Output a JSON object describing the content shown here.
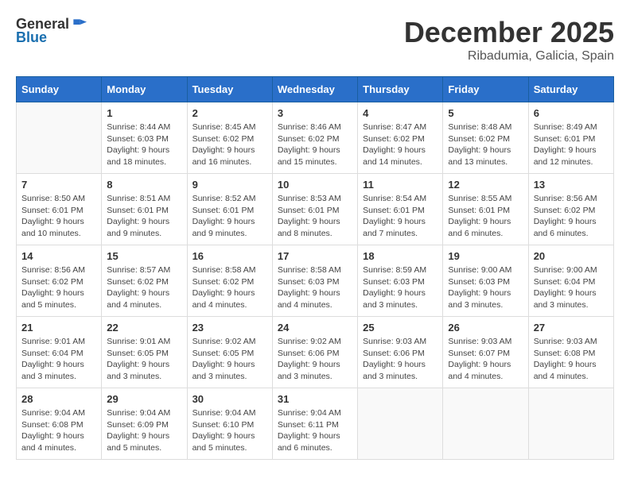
{
  "header": {
    "logo_general": "General",
    "logo_blue": "Blue",
    "month_year": "December 2025",
    "location": "Ribadumia, Galicia, Spain"
  },
  "weekdays": [
    "Sunday",
    "Monday",
    "Tuesday",
    "Wednesday",
    "Thursday",
    "Friday",
    "Saturday"
  ],
  "weeks": [
    [
      {
        "day": "",
        "info": ""
      },
      {
        "day": "1",
        "info": "Sunrise: 8:44 AM\nSunset: 6:03 PM\nDaylight: 9 hours\nand 18 minutes."
      },
      {
        "day": "2",
        "info": "Sunrise: 8:45 AM\nSunset: 6:02 PM\nDaylight: 9 hours\nand 16 minutes."
      },
      {
        "day": "3",
        "info": "Sunrise: 8:46 AM\nSunset: 6:02 PM\nDaylight: 9 hours\nand 15 minutes."
      },
      {
        "day": "4",
        "info": "Sunrise: 8:47 AM\nSunset: 6:02 PM\nDaylight: 9 hours\nand 14 minutes."
      },
      {
        "day": "5",
        "info": "Sunrise: 8:48 AM\nSunset: 6:02 PM\nDaylight: 9 hours\nand 13 minutes."
      },
      {
        "day": "6",
        "info": "Sunrise: 8:49 AM\nSunset: 6:01 PM\nDaylight: 9 hours\nand 12 minutes."
      }
    ],
    [
      {
        "day": "7",
        "info": "Sunrise: 8:50 AM\nSunset: 6:01 PM\nDaylight: 9 hours\nand 10 minutes."
      },
      {
        "day": "8",
        "info": "Sunrise: 8:51 AM\nSunset: 6:01 PM\nDaylight: 9 hours\nand 9 minutes."
      },
      {
        "day": "9",
        "info": "Sunrise: 8:52 AM\nSunset: 6:01 PM\nDaylight: 9 hours\nand 9 minutes."
      },
      {
        "day": "10",
        "info": "Sunrise: 8:53 AM\nSunset: 6:01 PM\nDaylight: 9 hours\nand 8 minutes."
      },
      {
        "day": "11",
        "info": "Sunrise: 8:54 AM\nSunset: 6:01 PM\nDaylight: 9 hours\nand 7 minutes."
      },
      {
        "day": "12",
        "info": "Sunrise: 8:55 AM\nSunset: 6:01 PM\nDaylight: 9 hours\nand 6 minutes."
      },
      {
        "day": "13",
        "info": "Sunrise: 8:56 AM\nSunset: 6:02 PM\nDaylight: 9 hours\nand 6 minutes."
      }
    ],
    [
      {
        "day": "14",
        "info": "Sunrise: 8:56 AM\nSunset: 6:02 PM\nDaylight: 9 hours\nand 5 minutes."
      },
      {
        "day": "15",
        "info": "Sunrise: 8:57 AM\nSunset: 6:02 PM\nDaylight: 9 hours\nand 4 minutes."
      },
      {
        "day": "16",
        "info": "Sunrise: 8:58 AM\nSunset: 6:02 PM\nDaylight: 9 hours\nand 4 minutes."
      },
      {
        "day": "17",
        "info": "Sunrise: 8:58 AM\nSunset: 6:03 PM\nDaylight: 9 hours\nand 4 minutes."
      },
      {
        "day": "18",
        "info": "Sunrise: 8:59 AM\nSunset: 6:03 PM\nDaylight: 9 hours\nand 3 minutes."
      },
      {
        "day": "19",
        "info": "Sunrise: 9:00 AM\nSunset: 6:03 PM\nDaylight: 9 hours\nand 3 minutes."
      },
      {
        "day": "20",
        "info": "Sunrise: 9:00 AM\nSunset: 6:04 PM\nDaylight: 9 hours\nand 3 minutes."
      }
    ],
    [
      {
        "day": "21",
        "info": "Sunrise: 9:01 AM\nSunset: 6:04 PM\nDaylight: 9 hours\nand 3 minutes."
      },
      {
        "day": "22",
        "info": "Sunrise: 9:01 AM\nSunset: 6:05 PM\nDaylight: 9 hours\nand 3 minutes."
      },
      {
        "day": "23",
        "info": "Sunrise: 9:02 AM\nSunset: 6:05 PM\nDaylight: 9 hours\nand 3 minutes."
      },
      {
        "day": "24",
        "info": "Sunrise: 9:02 AM\nSunset: 6:06 PM\nDaylight: 9 hours\nand 3 minutes."
      },
      {
        "day": "25",
        "info": "Sunrise: 9:03 AM\nSunset: 6:06 PM\nDaylight: 9 hours\nand 3 minutes."
      },
      {
        "day": "26",
        "info": "Sunrise: 9:03 AM\nSunset: 6:07 PM\nDaylight: 9 hours\nand 4 minutes."
      },
      {
        "day": "27",
        "info": "Sunrise: 9:03 AM\nSunset: 6:08 PM\nDaylight: 9 hours\nand 4 minutes."
      }
    ],
    [
      {
        "day": "28",
        "info": "Sunrise: 9:04 AM\nSunset: 6:08 PM\nDaylight: 9 hours\nand 4 minutes."
      },
      {
        "day": "29",
        "info": "Sunrise: 9:04 AM\nSunset: 6:09 PM\nDaylight: 9 hours\nand 5 minutes."
      },
      {
        "day": "30",
        "info": "Sunrise: 9:04 AM\nSunset: 6:10 PM\nDaylight: 9 hours\nand 5 minutes."
      },
      {
        "day": "31",
        "info": "Sunrise: 9:04 AM\nSunset: 6:11 PM\nDaylight: 9 hours\nand 6 minutes."
      },
      {
        "day": "",
        "info": ""
      },
      {
        "day": "",
        "info": ""
      },
      {
        "day": "",
        "info": ""
      }
    ]
  ]
}
